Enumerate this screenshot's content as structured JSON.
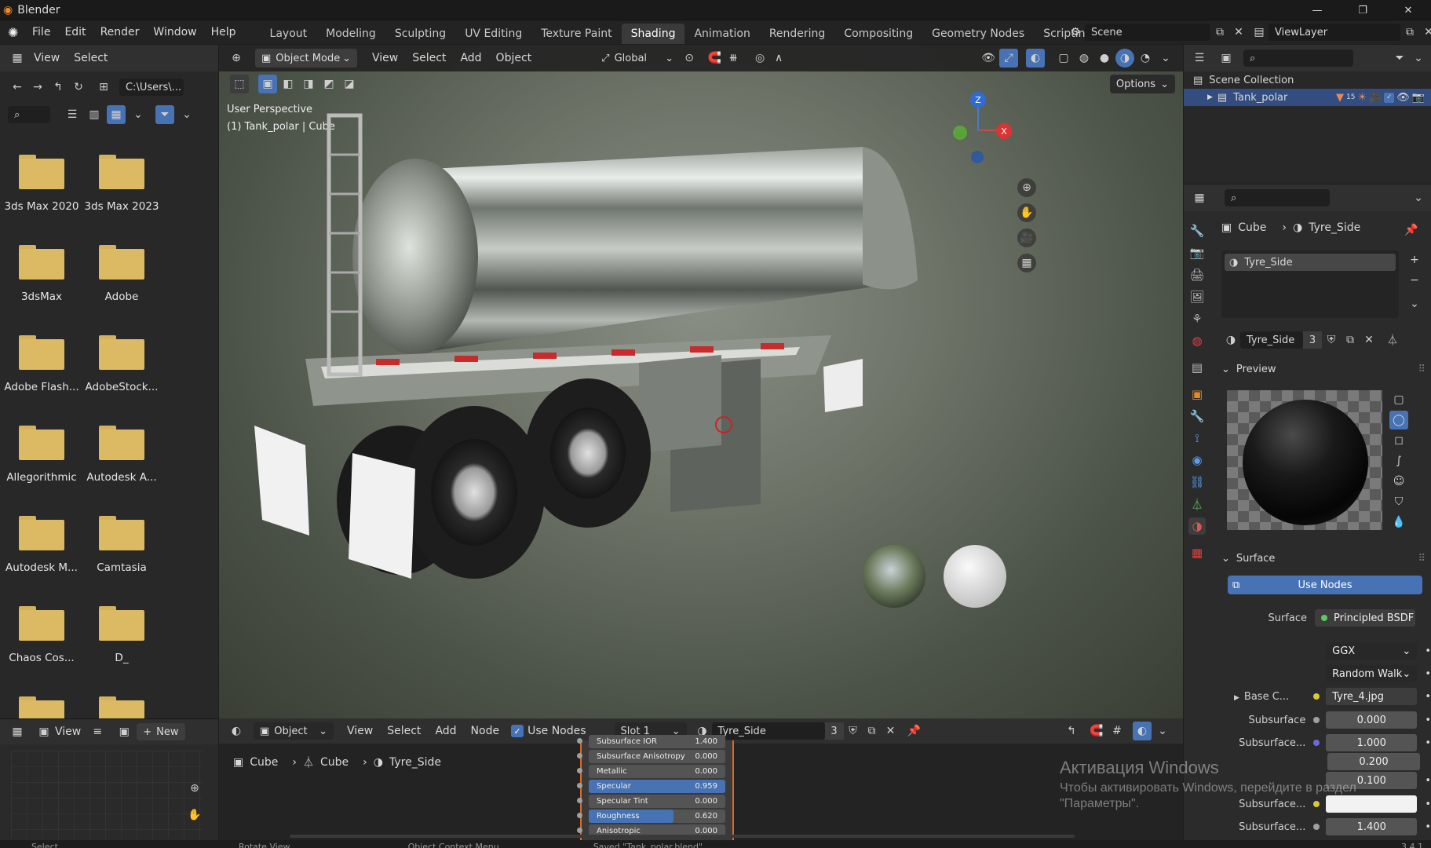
{
  "window": {
    "title": "Blender",
    "controls": [
      "—",
      "❐",
      "✕"
    ]
  },
  "menubar": {
    "items": [
      "File",
      "Edit",
      "Render",
      "Window",
      "Help"
    ]
  },
  "workspaces": {
    "tabs": [
      "Layout",
      "Modeling",
      "Sculpting",
      "UV Editing",
      "Texture Paint",
      "Shading",
      "Animation",
      "Rendering",
      "Compositing",
      "Geometry Nodes",
      "Scripting"
    ],
    "active": "Shading",
    "add": "+"
  },
  "scene": {
    "name": "Scene",
    "viewlayer": "ViewLayer"
  },
  "filebrowser": {
    "menu": [
      "View",
      "Select"
    ],
    "path": "C:\\Users\\...",
    "folders": [
      "3ds Max 2020",
      "3ds Max 2023",
      "3dsMax",
      "Adobe",
      "Adobe Flash...",
      "AdobeStock...",
      "Allegorithmic",
      "Autodesk A...",
      "Autodesk M...",
      "Camtasia",
      "Chaos Cos...",
      "D_"
    ]
  },
  "viewport": {
    "mode": "Object Mode",
    "menu": [
      "View",
      "Select",
      "Add",
      "Object"
    ],
    "transform": "Global",
    "options": "Options",
    "overlay_line1": "User Perspective",
    "overlay_line2": "(1) Tank_polar | Cube",
    "axis_z": "Z",
    "axis_x": "X"
  },
  "outliner": {
    "collection": "Scene Collection",
    "object": "Tank_polar",
    "badge": "15"
  },
  "properties": {
    "breadcrumb_obj": "Cube",
    "breadcrumb_mat": "Tyre_Side",
    "slot": "Tyre_Side",
    "material_name": "Tyre_Side",
    "users": "3",
    "preview_label": "Preview",
    "surface_label": "Surface",
    "use_nodes": "Use Nodes",
    "rows": [
      {
        "label": "Surface",
        "value": "Principled BSDF",
        "dot": "#5ec95e"
      },
      {
        "label": "",
        "value": "GGX"
      },
      {
        "label": "",
        "value": "Random Walk"
      },
      {
        "label": "Base C...",
        "value": "Tyre_4.jpg",
        "dot": "#d8c83a"
      },
      {
        "label": "Subsurface",
        "value": "0.000",
        "dot": "#a0a0a0"
      },
      {
        "label": "Subsurface...",
        "value": "1.000",
        "dot": "#6a6ad8"
      },
      {
        "label": "",
        "value": "0.200"
      },
      {
        "label": "",
        "value": "0.100"
      },
      {
        "label": "Subsurface...",
        "value": "",
        "dot": "#d8c83a"
      },
      {
        "label": "Subsurface...",
        "value": "1.400",
        "dot": "#a0a0a0"
      }
    ]
  },
  "node_editor": {
    "object": "Object",
    "menu": [
      "View",
      "Select",
      "Add",
      "Node"
    ],
    "use_nodes": "Use Nodes",
    "slot": "Slot 1",
    "material": "Tyre_Side",
    "users": "3",
    "breadcrumb": [
      "Cube",
      "Cube",
      "Tyre_Side"
    ],
    "rows": [
      {
        "name": "Subsurface IOR",
        "value": "1.400",
        "fill": 0
      },
      {
        "name": "Subsurface Anisotropy",
        "value": "0.000",
        "fill": 0
      },
      {
        "name": "Metallic",
        "value": "0.000",
        "fill": 0
      },
      {
        "name": "Specular",
        "value": "0.959",
        "fill": 1
      },
      {
        "name": "Specular Tint",
        "value": "0.000",
        "fill": 0
      },
      {
        "name": "Roughness",
        "value": "0.620",
        "fill": 0.62
      },
      {
        "name": "Anisotropic",
        "value": "0.000",
        "fill": 0
      }
    ]
  },
  "small_editor": {
    "view": "View",
    "new": "New"
  },
  "watermark": {
    "title": "Активация Windows",
    "line1": "Чтобы активировать Windows, перейдите в раздел",
    "line2": "\"Параметры\"."
  },
  "statusbar": {
    "items": [
      "Select",
      "Rotate View",
      "Object Context Menu"
    ],
    "saved": "Saved \"Tank_polar.blend\"",
    "version": "3.4.1"
  }
}
